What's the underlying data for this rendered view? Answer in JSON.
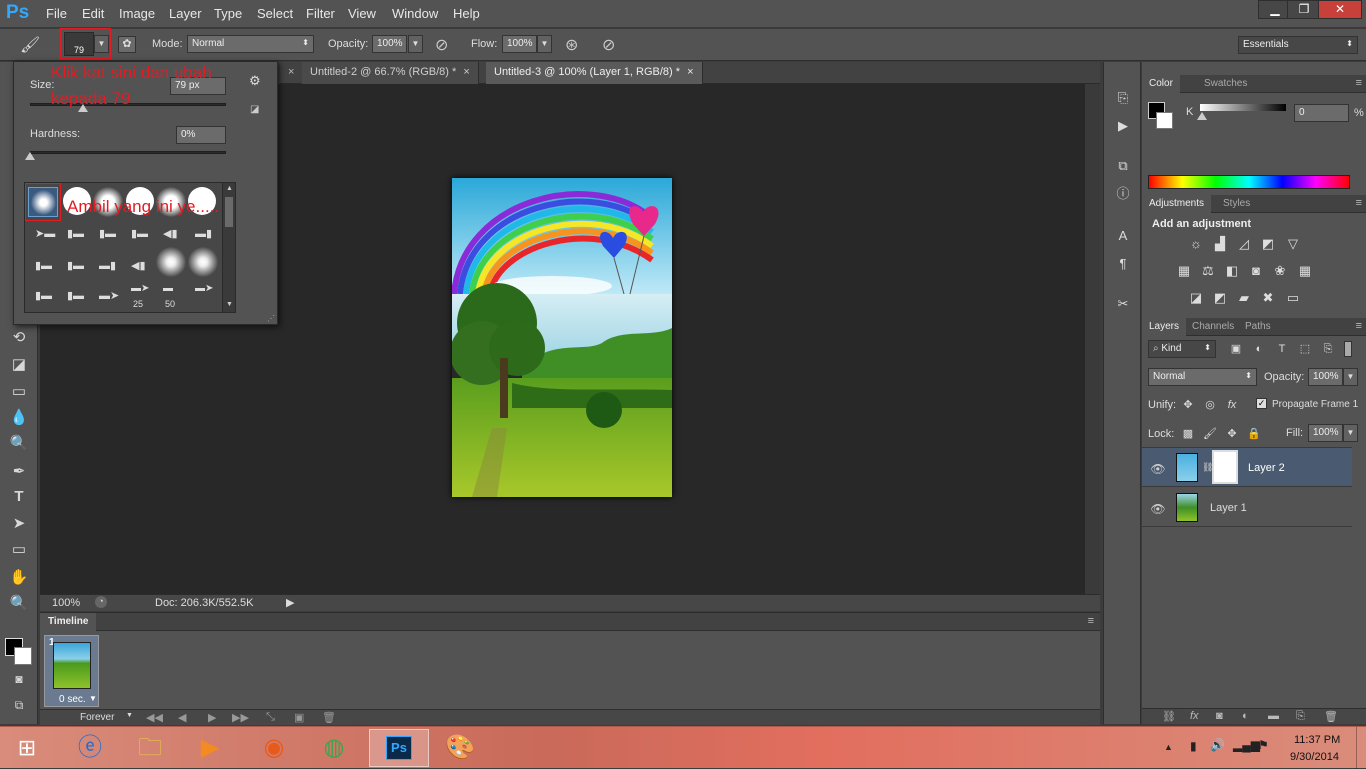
{
  "app": {
    "logo": "Ps"
  },
  "menu": [
    "File",
    "Edit",
    "Image",
    "Layer",
    "Type",
    "Select",
    "Filter",
    "View",
    "Window",
    "Help"
  ],
  "window_controls": {
    "minimize": "▁",
    "restore": "❐",
    "close": "✕"
  },
  "options": {
    "brush_size": "79",
    "mode_label": "Mode:",
    "mode_value": "Normal",
    "opacity_label": "Opacity:",
    "opacity_value": "100%",
    "flow_label": "Flow:",
    "flow_value": "100%",
    "workspace": "Essentials"
  },
  "tabs": [
    {
      "label": "Untitled-2 @ 66.7% (RGB/8) *",
      "close": "×"
    },
    {
      "label": "Untitled-3 @ 100% (Layer 1, RGB/8) *",
      "close": "×"
    }
  ],
  "brush_panel": {
    "size_label": "Size:",
    "size_value": "79 px",
    "size_fraction": 0.27,
    "hardness_label": "Hardness:",
    "hardness_value": "0%",
    "hardness_fraction": 0.0,
    "numbers": [
      "25",
      "50"
    ]
  },
  "annotations": {
    "size_note": "Klik kat sini dan ubah kepada 79",
    "brush_note": "Ambil yang ini ye....."
  },
  "status": {
    "zoom": "100%",
    "doc": "Doc: 206.3K/552.5K"
  },
  "timeline": {
    "title": "Timeline",
    "frame_number": "1",
    "frame_delay": "0 sec.",
    "loop": "Forever"
  },
  "color_panel": {
    "tabs": [
      "Color",
      "Swatches"
    ],
    "channel": "K",
    "value": "0",
    "percent": "%"
  },
  "adjustments_panel": {
    "tabs": [
      "Adjustments",
      "Styles"
    ],
    "heading": "Add an adjustment"
  },
  "layers_panel": {
    "tabs": [
      "Layers",
      "Channels",
      "Paths"
    ],
    "filter": "Kind",
    "blend_mode": "Normal",
    "opacity_label": "Opacity:",
    "opacity_value": "100%",
    "unify_label": "Unify:",
    "propagate_label": "Propagate Frame 1",
    "lock_label": "Lock:",
    "fill_label": "Fill:",
    "fill_value": "100%",
    "layers": [
      {
        "name": "Layer 2",
        "selected": true
      },
      {
        "name": "Layer 1",
        "selected": false
      }
    ]
  },
  "taskbar": {
    "time": "11:37 PM",
    "date": "9/30/2014"
  },
  "colors": {
    "accent": "#31a8ff",
    "annotation": "#e31b23",
    "panel": "#535353",
    "canvas_bg": "#282828",
    "selected_layer": "#4a5a70"
  }
}
